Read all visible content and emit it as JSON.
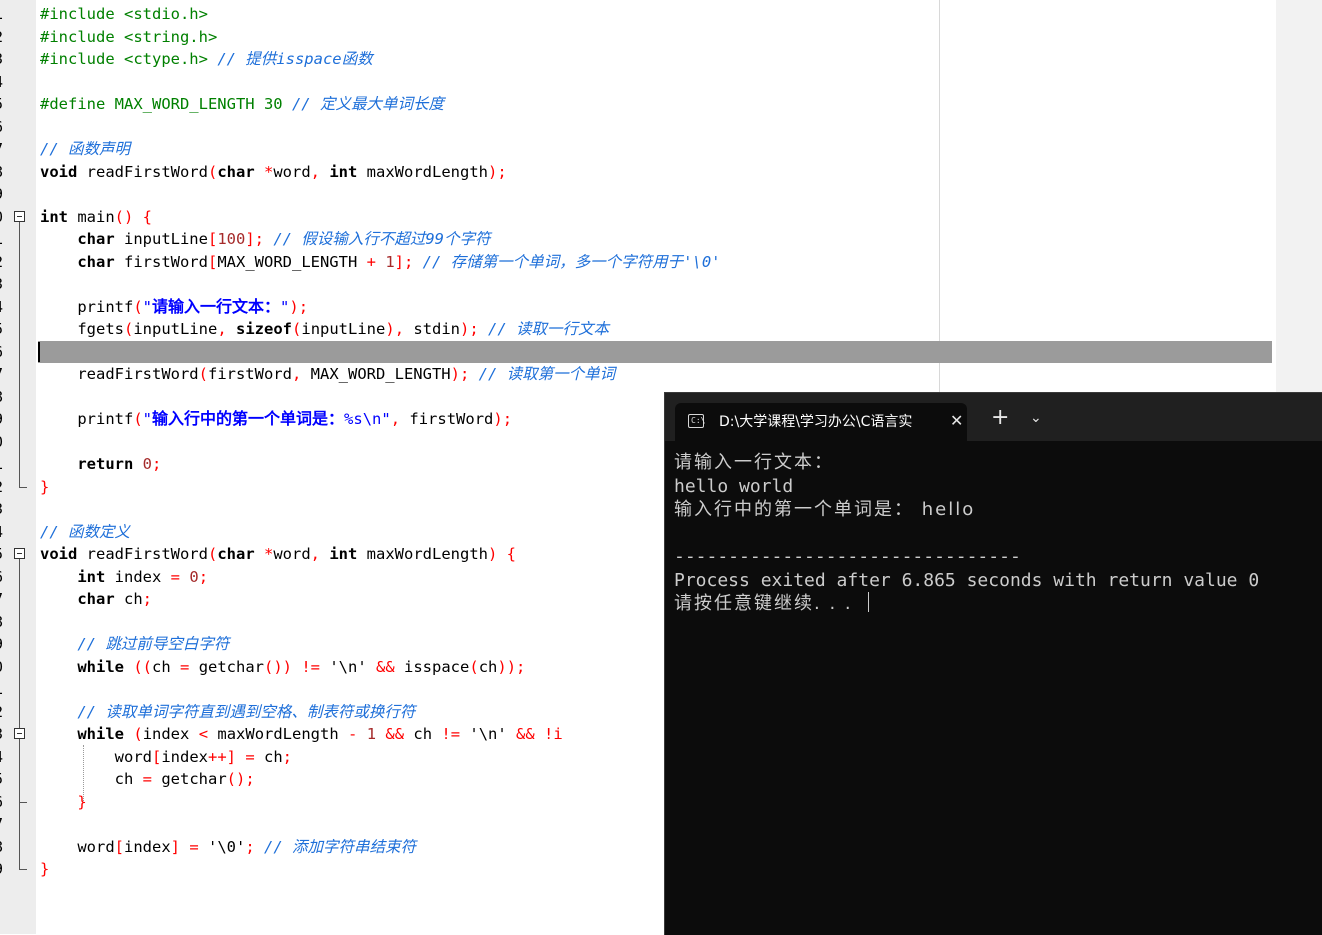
{
  "editor": {
    "line_numbers": [
      "1",
      "2",
      "3",
      "4",
      "5",
      "6",
      "7",
      "8",
      "9",
      "0",
      "1",
      "2",
      "3",
      "4",
      "5",
      "6",
      "7",
      "8",
      "9",
      "0",
      "1",
      "2",
      "3",
      "4",
      "5",
      "6",
      "7",
      "8",
      "9",
      "0",
      "1",
      "2",
      "3",
      "4",
      "5",
      "6",
      "7",
      "8",
      "9"
    ],
    "lines": [
      [
        {
          "t": "#include <stdio.h>",
          "c": "pp"
        }
      ],
      [
        {
          "t": "#include <string.h>",
          "c": "pp"
        }
      ],
      [
        {
          "t": "#include <ctype.h> ",
          "c": "pp"
        },
        {
          "t": "// 提供isspace函数",
          "c": "cm"
        }
      ],
      [],
      [
        {
          "t": "#define MAX_WORD_LENGTH 30 ",
          "c": "pp"
        },
        {
          "t": "// 定义最大单词长度",
          "c": "cm"
        }
      ],
      [],
      [
        {
          "t": "// 函数声明",
          "c": "cm"
        }
      ],
      [
        {
          "t": "void",
          "c": "kw"
        },
        {
          "t": " readFirstWord",
          "c": ""
        },
        {
          "t": "(",
          "c": "op"
        },
        {
          "t": "char",
          "c": "kw"
        },
        {
          "t": " ",
          "c": ""
        },
        {
          "t": "*",
          "c": "op"
        },
        {
          "t": "word",
          "c": ""
        },
        {
          "t": ", ",
          "c": "op"
        },
        {
          "t": "int",
          "c": "kw"
        },
        {
          "t": " maxWordLength",
          "c": ""
        },
        {
          "t": ");",
          "c": "op"
        }
      ],
      [],
      [
        {
          "t": "int",
          "c": "kw"
        },
        {
          "t": " main",
          "c": ""
        },
        {
          "t": "() {",
          "c": "op"
        }
      ],
      [
        {
          "t": "    ",
          "c": ""
        },
        {
          "t": "char",
          "c": "kw"
        },
        {
          "t": " inputLine",
          "c": ""
        },
        {
          "t": "[",
          "c": "op"
        },
        {
          "t": "100",
          "c": "num"
        },
        {
          "t": "]; ",
          "c": "op"
        },
        {
          "t": "// 假设输入行不超过99个字符",
          "c": "cm"
        }
      ],
      [
        {
          "t": "    ",
          "c": ""
        },
        {
          "t": "char",
          "c": "kw"
        },
        {
          "t": " firstWord",
          "c": ""
        },
        {
          "t": "[",
          "c": "op"
        },
        {
          "t": "MAX_WORD_LENGTH ",
          "c": ""
        },
        {
          "t": "+",
          "c": "op"
        },
        {
          "t": " ",
          "c": ""
        },
        {
          "t": "1",
          "c": "num"
        },
        {
          "t": "]; ",
          "c": "op"
        },
        {
          "t": "// 存储第一个单词，多一个字符用于'\\0'",
          "c": "cm"
        }
      ],
      [],
      [
        {
          "t": "    printf",
          "c": ""
        },
        {
          "t": "(",
          "c": "op"
        },
        {
          "t": "\"",
          "c": "str"
        },
        {
          "t": "请输入一行文本：",
          "c": "strb"
        },
        {
          "t": "\"",
          "c": "str"
        },
        {
          "t": ");",
          "c": "op"
        }
      ],
      [
        {
          "t": "    fgets",
          "c": ""
        },
        {
          "t": "(",
          "c": "op"
        },
        {
          "t": "inputLine",
          "c": ""
        },
        {
          "t": ", ",
          "c": "op"
        },
        {
          "t": "sizeof",
          "c": "kw"
        },
        {
          "t": "(",
          "c": "op"
        },
        {
          "t": "inputLine",
          "c": ""
        },
        {
          "t": "), ",
          "c": "op"
        },
        {
          "t": "stdin",
          "c": ""
        },
        {
          "t": "); ",
          "c": "op"
        },
        {
          "t": "// 读取一行文本",
          "c": "cm"
        }
      ],
      [],
      [
        {
          "t": "    readFirstWord",
          "c": ""
        },
        {
          "t": "(",
          "c": "op"
        },
        {
          "t": "firstWord",
          "c": ""
        },
        {
          "t": ", ",
          "c": "op"
        },
        {
          "t": "MAX_WORD_LENGTH",
          "c": ""
        },
        {
          "t": "); ",
          "c": "op"
        },
        {
          "t": "// 读取第一个单词",
          "c": "cm"
        }
      ],
      [],
      [
        {
          "t": "    printf",
          "c": ""
        },
        {
          "t": "(",
          "c": "op"
        },
        {
          "t": "\"",
          "c": "str"
        },
        {
          "t": "输入行中的第一个单词是：",
          "c": "strb"
        },
        {
          "t": "%s\\n\"",
          "c": "str"
        },
        {
          "t": ", ",
          "c": "op"
        },
        {
          "t": "firstWord",
          "c": ""
        },
        {
          "t": ");",
          "c": "op"
        }
      ],
      [],
      [
        {
          "t": "    ",
          "c": ""
        },
        {
          "t": "return",
          "c": "kw"
        },
        {
          "t": " ",
          "c": ""
        },
        {
          "t": "0",
          "c": "num"
        },
        {
          "t": ";",
          "c": "op"
        }
      ],
      [
        {
          "t": "}",
          "c": "op"
        }
      ],
      [],
      [
        {
          "t": "// 函数定义",
          "c": "cm"
        }
      ],
      [
        {
          "t": "void",
          "c": "kw"
        },
        {
          "t": " readFirstWord",
          "c": ""
        },
        {
          "t": "(",
          "c": "op"
        },
        {
          "t": "char",
          "c": "kw"
        },
        {
          "t": " ",
          "c": ""
        },
        {
          "t": "*",
          "c": "op"
        },
        {
          "t": "word",
          "c": ""
        },
        {
          "t": ", ",
          "c": "op"
        },
        {
          "t": "int",
          "c": "kw"
        },
        {
          "t": " maxWordLength",
          "c": ""
        },
        {
          "t": ") {",
          "c": "op"
        }
      ],
      [
        {
          "t": "    ",
          "c": ""
        },
        {
          "t": "int",
          "c": "kw"
        },
        {
          "t": " index ",
          "c": ""
        },
        {
          "t": "=",
          "c": "op"
        },
        {
          "t": " ",
          "c": ""
        },
        {
          "t": "0",
          "c": "num"
        },
        {
          "t": ";",
          "c": "op"
        }
      ],
      [
        {
          "t": "    ",
          "c": ""
        },
        {
          "t": "char",
          "c": "kw"
        },
        {
          "t": " ch",
          "c": ""
        },
        {
          "t": ";",
          "c": "op"
        }
      ],
      [],
      [
        {
          "t": "    ",
          "c": ""
        },
        {
          "t": "// 跳过前导空白字符",
          "c": "cm"
        }
      ],
      [
        {
          "t": "    ",
          "c": ""
        },
        {
          "t": "while",
          "c": "kw"
        },
        {
          "t": " ",
          "c": ""
        },
        {
          "t": "((",
          "c": "op"
        },
        {
          "t": "ch ",
          "c": ""
        },
        {
          "t": "=",
          "c": "op"
        },
        {
          "t": " getchar",
          "c": ""
        },
        {
          "t": "()) != ",
          "c": "op"
        },
        {
          "t": "'\\n' ",
          "c": "chr"
        },
        {
          "t": "&&",
          "c": "op"
        },
        {
          "t": " isspace",
          "c": ""
        },
        {
          "t": "(",
          "c": "op"
        },
        {
          "t": "ch",
          "c": ""
        },
        {
          "t": "));",
          "c": "op"
        }
      ],
      [],
      [
        {
          "t": "    ",
          "c": ""
        },
        {
          "t": "// 读取单词字符直到遇到空格、制表符或换行符",
          "c": "cm"
        }
      ],
      [
        {
          "t": "    ",
          "c": ""
        },
        {
          "t": "while",
          "c": "kw"
        },
        {
          "t": " ",
          "c": ""
        },
        {
          "t": "(",
          "c": "op"
        },
        {
          "t": "index ",
          "c": ""
        },
        {
          "t": "<",
          "c": "op"
        },
        {
          "t": " maxWordLength ",
          "c": ""
        },
        {
          "t": "-",
          "c": "op"
        },
        {
          "t": " ",
          "c": ""
        },
        {
          "t": "1",
          "c": "num"
        },
        {
          "t": " && ",
          "c": "op"
        },
        {
          "t": "ch ",
          "c": ""
        },
        {
          "t": "!=",
          "c": "op"
        },
        {
          "t": " '\\n' ",
          "c": "chr"
        },
        {
          "t": "&& !i",
          "c": "op"
        }
      ],
      [
        {
          "t": "        word",
          "c": ""
        },
        {
          "t": "[",
          "c": "op"
        },
        {
          "t": "index",
          "c": ""
        },
        {
          "t": "++] = ",
          "c": "op"
        },
        {
          "t": "ch",
          "c": ""
        },
        {
          "t": ";",
          "c": "op"
        }
      ],
      [
        {
          "t": "        ch ",
          "c": ""
        },
        {
          "t": "=",
          "c": "op"
        },
        {
          "t": " getchar",
          "c": ""
        },
        {
          "t": "();",
          "c": "op"
        }
      ],
      [
        {
          "t": "    ",
          "c": ""
        },
        {
          "t": "}",
          "c": "op"
        }
      ],
      [],
      [
        {
          "t": "    word",
          "c": ""
        },
        {
          "t": "[",
          "c": "op"
        },
        {
          "t": "index",
          "c": ""
        },
        {
          "t": "] = ",
          "c": "op"
        },
        {
          "t": "'\\0'",
          "c": "chr"
        },
        {
          "t": "; ",
          "c": "op"
        },
        {
          "t": "// 添加字符串结束符",
          "c": "cm"
        }
      ],
      [
        {
          "t": "}",
          "c": "op"
        }
      ]
    ],
    "current_line_index": 15
  },
  "terminal": {
    "tab_title": "D:\\大学课程\\学习办公\\C语言实",
    "tab_icon": "terminal-app-icon",
    "close_glyph": "✕",
    "new_tab_glyph": "+",
    "dropdown_glyph": "⌄",
    "output": [
      "请输入一行文本：",
      "hello world",
      "输入行中的第一个单词是： hello",
      "",
      "--------------------------------",
      "Process exited after 6.865 seconds with return value 0",
      "请按任意键继续. . . "
    ]
  },
  "colors": {
    "terminal_bg": "#0c0c0c",
    "terminal_text": "#cccccc",
    "comment": "#1e6fd9",
    "preprocessor": "#008000",
    "operator": "#ff0000",
    "number": "#a52a2a",
    "string": "#0000ff",
    "current_line": "#9b9b9b"
  }
}
